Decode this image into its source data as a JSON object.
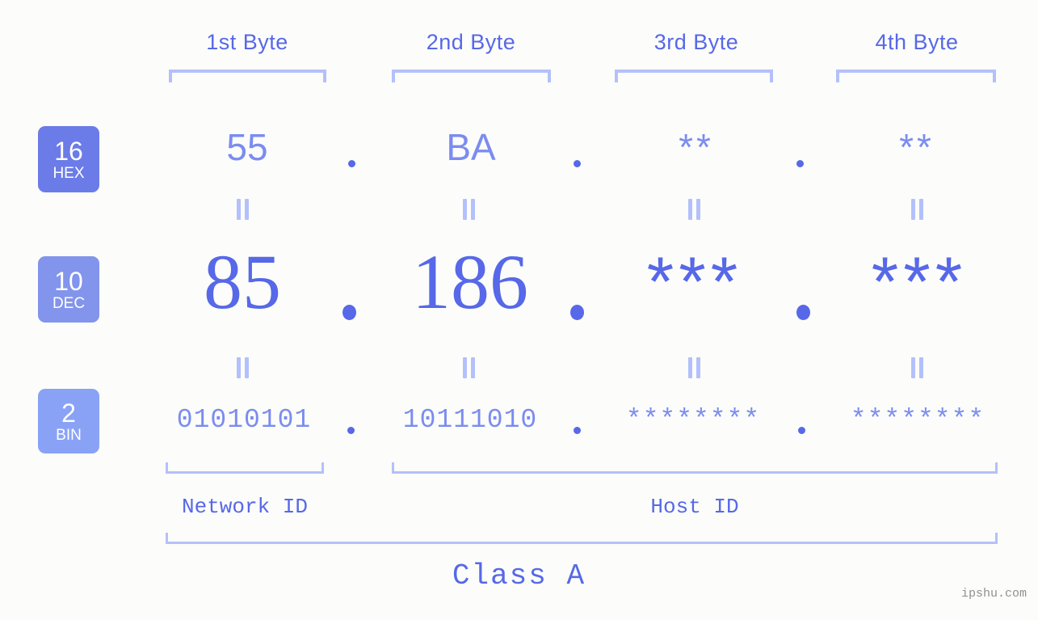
{
  "background_color": "#fcfdfa",
  "accent_color": "#5768e8",
  "accent_light_color": "#7b8cf0",
  "bracket_color": "#b4c0fb",
  "byte_headers": [
    {
      "label": "1st Byte"
    },
    {
      "label": "2nd Byte"
    },
    {
      "label": "3rd Byte"
    },
    {
      "label": "4th Byte"
    }
  ],
  "rows": {
    "hex": {
      "radix": "16",
      "system": "HEX",
      "badge_color": "#6b7ce8",
      "values": [
        "55",
        "BA",
        "**",
        "**"
      ],
      "separator": "."
    },
    "dec": {
      "radix": "10",
      "system": "DEC",
      "badge_color": "#8394ec",
      "values": [
        "85",
        "186",
        "***",
        "***"
      ],
      "separator": "."
    },
    "bin": {
      "radix": "2",
      "system": "BIN",
      "badge_color": "#8aa2f6",
      "values": [
        "01010101",
        "10111010",
        "********",
        "********"
      ],
      "separator": "."
    }
  },
  "equality_symbol": "=",
  "id_labels": [
    {
      "label": "Network ID"
    },
    {
      "label": "Host ID"
    }
  ],
  "class_label": "Class A",
  "watermark": "ipshu.com"
}
